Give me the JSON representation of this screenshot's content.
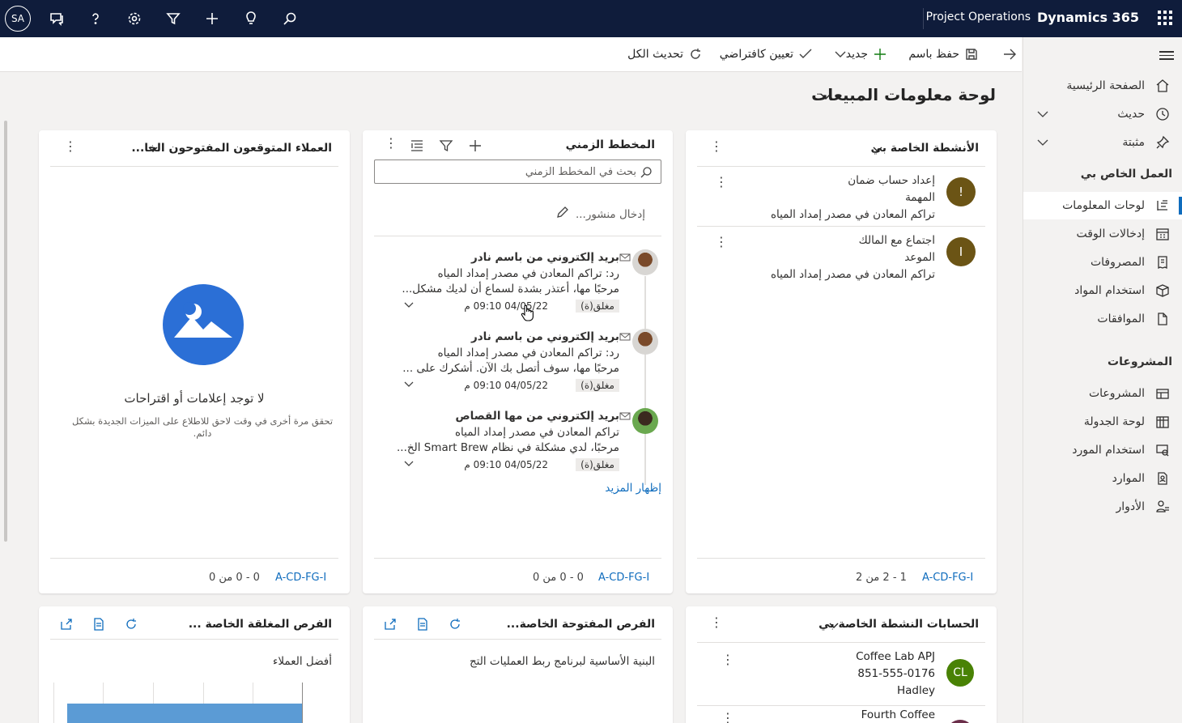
{
  "topbar": {
    "avatar_initials": "SA",
    "app_name": "Project Operations",
    "brand": "Dynamics 365"
  },
  "sidebar": {
    "items_top": [
      {
        "label": "الصفحة الرئيسية",
        "icon": "home-icon"
      },
      {
        "label": "حديث",
        "icon": "clock-icon"
      },
      {
        "label": "مثبتة",
        "icon": "pin-icon"
      }
    ],
    "section_my_work": "العمل الخاص بي",
    "my_work": [
      {
        "label": "لوحات المعلومات",
        "icon": "dashboard-icon"
      },
      {
        "label": "إدخالات الوقت",
        "icon": "calendar-icon"
      },
      {
        "label": "المصروفات",
        "icon": "receipt-icon"
      },
      {
        "label": "استخدام المواد",
        "icon": "box-icon"
      },
      {
        "label": "الموافقات",
        "icon": "document-icon"
      }
    ],
    "section_projects": "المشروعات",
    "projects": [
      {
        "label": "المشروعات",
        "icon": "project-icon"
      },
      {
        "label": "لوحة الجدولة",
        "icon": "schedule-icon"
      },
      {
        "label": "استخدام المورد",
        "icon": "resource-icon"
      },
      {
        "label": "الموارد",
        "icon": "resources-icon"
      },
      {
        "label": "الأدوار",
        "icon": "roles-icon"
      }
    ]
  },
  "commandbar": {
    "save_as": "حفظ باسم",
    "new": "جديد",
    "set_default": "تعيين كافتراضي",
    "refresh_all": "تحديث الكل"
  },
  "page": {
    "title": "لوحة معلومات المبيعات"
  },
  "activities": {
    "title": "الأنشطة الخاصة بي",
    "rows": [
      {
        "avatar": "!",
        "line1": "إعداد حساب ضمان",
        "line2": "المهمة",
        "line3": "تراكم المعادن في مصدر إمداد المياه"
      },
      {
        "avatar": "I",
        "line1": "اجتماع مع المالك",
        "line2": "الموعد",
        "line3": "تراكم المعادن في مصدر إمداد المياه"
      }
    ],
    "footer_letters": "A-CD-FG-I",
    "footer_count": "1 - 2 من 2"
  },
  "timeline": {
    "title": "المخطط الزمني",
    "search_placeholder": "بحث في المخطط الزمني",
    "post_placeholder": "إدخال منشور...",
    "items": [
      {
        "title": "بريد إلكتروني من باسم نادر",
        "line1": "رد: تراكم المعادن في مصدر إمداد المياه",
        "line2": "مرحبًا مها، أعتذر بشدة لسماع أن لديك مشكل...",
        "status": "مغلق(ة)",
        "date": "04/05/22 09:10 م"
      },
      {
        "title": "بريد إلكتروني من باسم نادر",
        "line1": "رد: تراكم المعادن في مصدر إمداد المياه",
        "line2": "مرحبًا مها، سوف أتصل بك الآن. أشكرك على ...",
        "status": "مغلق(ة)",
        "date": "04/05/22 09:10 م"
      },
      {
        "title": "بريد إلكتروني من مها القصاص",
        "line1": "تراكم المعادن في مصدر إمداد المياه",
        "line2": "مرحبًا، لدي مشكلة في نظام Smart Brew الخ...",
        "status": "مغلق(ة)",
        "date": "04/05/22 09:10 م"
      }
    ],
    "show_more": "إظهار المزيد",
    "footer_letters": "A-CD-FG-I",
    "footer_count": "0 - 0 من 0"
  },
  "leads": {
    "title": "العملاء المتوقعون المفتوحون الخا...",
    "empty_title": "لا توجد إعلامات أو اقتراحات",
    "empty_sub": "تحقق مرة أخرى في وقت لاحق للاطلاع على الميزات الجديدة بشكل دائم.",
    "footer_letters": "A-CD-FG-I",
    "footer_count": "0 - 0 من 0"
  },
  "accounts": {
    "title": "الحسابات النشطة الخاصة بي",
    "rows": [
      {
        "initials": "CL",
        "name": "Coffee Lab APJ",
        "phone": "851-555-0176",
        "city": "Hadley",
        "color": "#498205"
      },
      {
        "initials": "",
        "name": "Fourth Coffee",
        "color": "#6b2f4a"
      }
    ]
  },
  "open_opps": {
    "title": "الفرص المفتوحة الخاصة...",
    "subtitle": "البنية الأساسية لبرنامج ربط العمليات التج"
  },
  "closed_opps": {
    "title": "الفرص المغلقة الخاصة ...",
    "subtitle": "أفضل العملاء"
  },
  "colors": {
    "topbar": "#0f1c3b",
    "accent": "#0f6cbd",
    "chart_bar": "#5b9bd5"
  }
}
